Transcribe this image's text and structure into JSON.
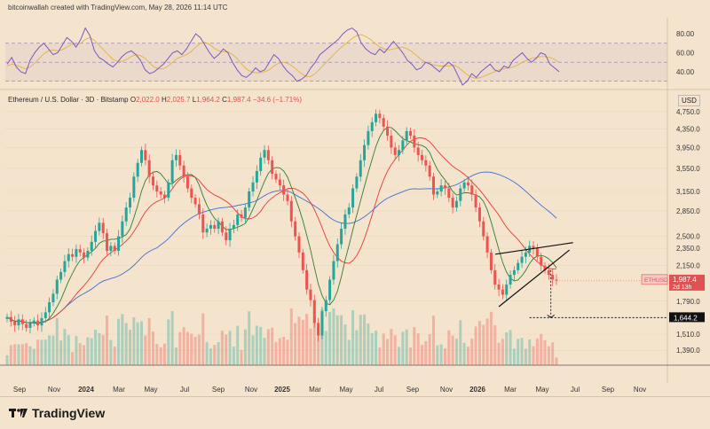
{
  "header_text": "bitcoinwallah created with TradingView.com, May 28, 2026 11:14 UTC",
  "symbol": {
    "title": "Ethereum / U.S. Dollar · 3D · Bitstamp",
    "open_label": "O",
    "open": "2,022.0",
    "high_label": "H",
    "high": "2,025.7",
    "low_label": "L",
    "low": "1,964.2",
    "close_label": "C",
    "close": "1,987.4",
    "change": "−34.6 (−1.71%)"
  },
  "currency": "USD",
  "brand": "TradingView",
  "colors": {
    "background": "#f5e4cd",
    "up": "#26a69a",
    "down": "#ef5350",
    "rsi": "#7e57c2",
    "rsi_ma": "#e3b341",
    "ma_fast": "#2e7d32",
    "ma_mid": "#e53935",
    "ma_slow": "#3f6fd8",
    "price_tag": "#e05252"
  },
  "chart_data": [
    {
      "type": "line",
      "name": "RSI",
      "ylim": [
        25,
        95
      ],
      "y_ticks": [
        "80.00",
        "60.00",
        "40.00"
      ],
      "levels": [
        70,
        50,
        30
      ],
      "series": [
        {
          "values": [
            48,
            55,
            45,
            40,
            38,
            52,
            60,
            66,
            70,
            64,
            58,
            60,
            68,
            76,
            72,
            66,
            74,
            86,
            78,
            62,
            55,
            52,
            48,
            45,
            50,
            56,
            60,
            62,
            58,
            52,
            42,
            38,
            40,
            44,
            48,
            54,
            60,
            62,
            58,
            64,
            72,
            80,
            76,
            68,
            60,
            54,
            58,
            64,
            60,
            50,
            42,
            36,
            34,
            38,
            44,
            40,
            42,
            50,
            58,
            54,
            46,
            40,
            36,
            30,
            32,
            36,
            44,
            50,
            58,
            62,
            66,
            70,
            74,
            80,
            84,
            86,
            82,
            70,
            64,
            60,
            58,
            64,
            60,
            66,
            72,
            66,
            60,
            52,
            48,
            42,
            44,
            50,
            48,
            44,
            40,
            46,
            50,
            46,
            36,
            26,
            30,
            38,
            34,
            40,
            44,
            48,
            42,
            40,
            46,
            44,
            52,
            56,
            60,
            54,
            50,
            54,
            60,
            58,
            48,
            44,
            40
          ]
        },
        {
          "values": [
            46,
            48,
            47,
            45,
            43,
            45,
            49,
            54,
            59,
            62,
            63,
            62,
            63,
            66,
            69,
            69,
            70,
            74,
            76,
            73,
            68,
            63,
            58,
            53,
            51,
            51,
            53,
            56,
            58,
            57,
            54,
            49,
            45,
            43,
            43,
            46,
            50,
            54,
            56,
            58,
            61,
            66,
            70,
            71,
            69,
            65,
            62,
            61,
            61,
            58,
            54,
            48,
            43,
            40,
            39,
            39,
            40,
            42,
            46,
            49,
            50,
            49,
            46,
            42,
            38,
            35,
            35,
            38,
            43,
            48,
            53,
            58,
            63,
            67,
            71,
            75,
            78,
            79,
            77,
            74,
            70,
            66,
            64,
            63,
            64,
            65,
            66,
            64,
            61,
            57,
            53,
            50,
            48,
            47,
            46,
            46,
            46,
            47,
            45,
            41,
            37,
            34,
            33,
            34,
            36,
            38,
            40,
            42,
            43,
            44,
            45,
            47,
            50,
            52,
            54,
            55,
            56,
            56,
            55,
            53,
            50
          ]
        }
      ]
    },
    {
      "type": "candlestick",
      "name": "Ethereum / U.S. Dollar",
      "y_ticks": [
        "4,750.0",
        "4,350.0",
        "3,950.0",
        "3,550.0",
        "3,150.0",
        "2,850.0",
        "2,500.0",
        "2,350.0",
        "2,150.0",
        "1,790.0",
        "1,510.0",
        "1,390.0"
      ],
      "x_ticks": [
        "Sep",
        "Nov",
        "2024",
        "Mar",
        "May",
        "Jul",
        "Sep",
        "Nov",
        "2025",
        "Mar",
        "May",
        "Jul",
        "Sep",
        "Nov",
        "2026",
        "Mar",
        "May",
        "Jul",
        "Sep",
        "Nov"
      ],
      "year_ticks": [
        "2024",
        "2025",
        "2026"
      ],
      "last_price": "1,987.4",
      "last_label": "ETHUSD",
      "last_countdown": "2d 13h",
      "target_price": "1,644.2",
      "closes": [
        1650,
        1610,
        1580,
        1630,
        1590,
        1560,
        1600,
        1620,
        1580,
        1640,
        1690,
        1780,
        1860,
        2000,
        2080,
        2200,
        2280,
        2250,
        2340,
        2300,
        2240,
        2320,
        2430,
        2570,
        2680,
        2540,
        2320,
        2380,
        2320,
        2500,
        2700,
        2900,
        3050,
        3400,
        3650,
        3900,
        3700,
        3400,
        3250,
        3150,
        3100,
        3050,
        3300,
        3700,
        3800,
        3600,
        3400,
        3200,
        3050,
        2950,
        2800,
        2550,
        2600,
        2650,
        2600,
        2700,
        2550,
        2450,
        2600,
        2650,
        2800,
        2750,
        2900,
        3150,
        3300,
        3500,
        3750,
        3900,
        3700,
        3450,
        3350,
        3250,
        3100,
        3000,
        2700,
        2500,
        2300,
        2100,
        1900,
        1800,
        1600,
        1500,
        1700,
        1800,
        2000,
        2200,
        2400,
        2600,
        2800,
        2900,
        3200,
        3400,
        3700,
        4000,
        4300,
        4500,
        4700,
        4600,
        4400,
        4200,
        3950,
        3800,
        3900,
        4100,
        4300,
        4200,
        3950,
        3800,
        3700,
        3600,
        3400,
        3100,
        3150,
        3250,
        3200,
        3050,
        2900,
        3000,
        3200,
        3300,
        3250,
        3100,
        2900,
        2700,
        2500,
        2300,
        2100,
        1950,
        1900,
        1850,
        1950,
        2050,
        2100,
        2180,
        2250,
        2300,
        2380,
        2350,
        2250,
        2150,
        2100,
        2050,
        2000,
        1990
      ]
    }
  ]
}
